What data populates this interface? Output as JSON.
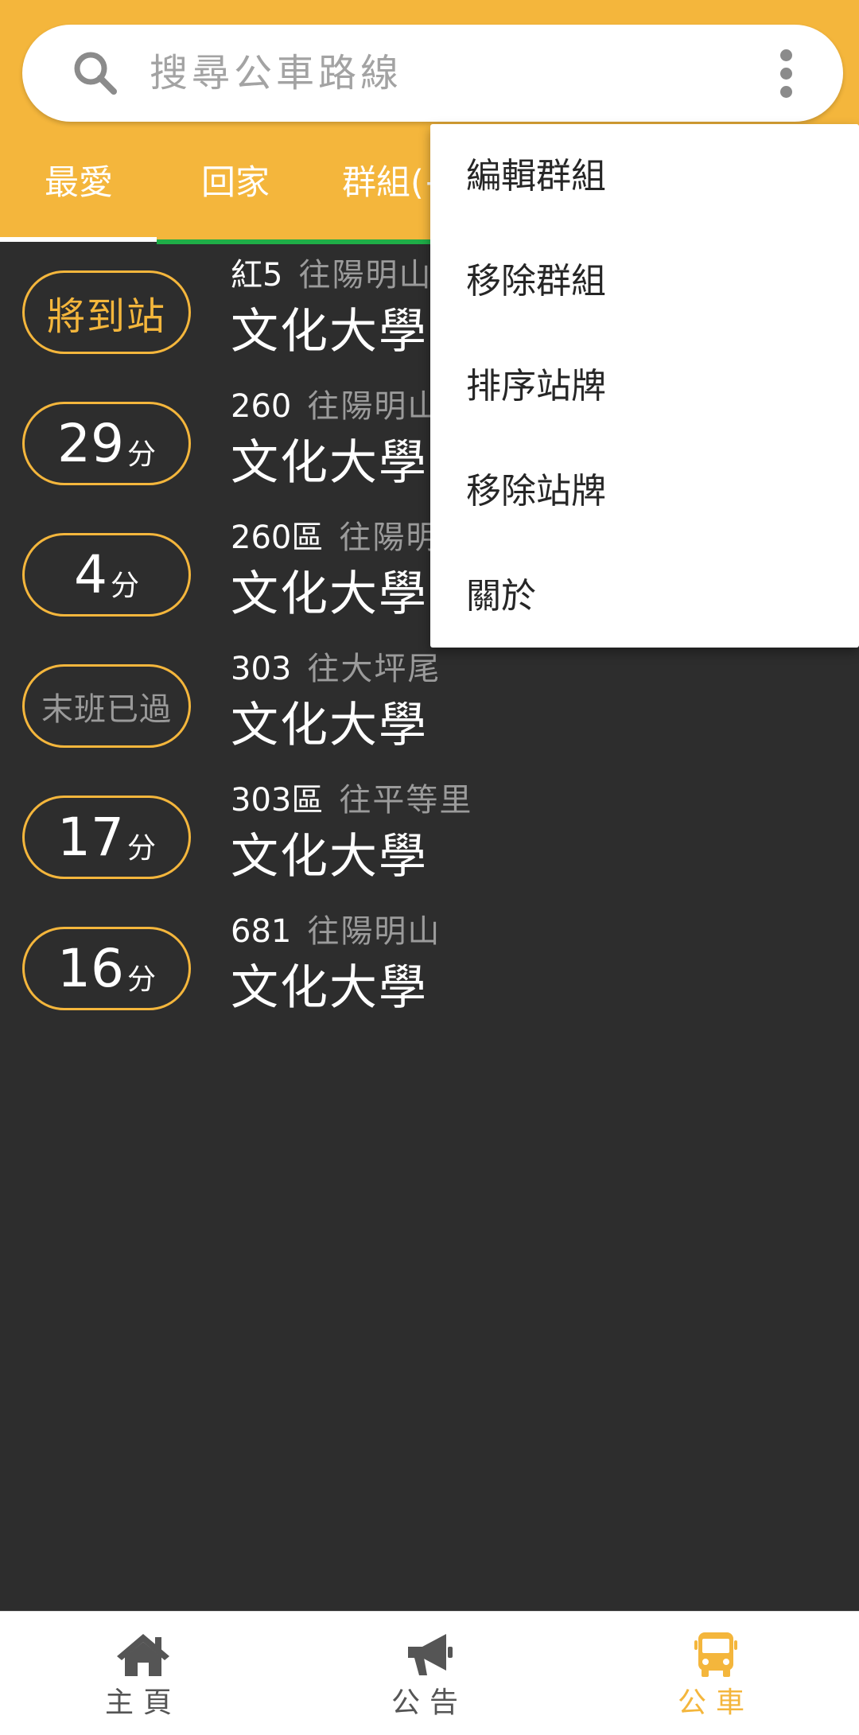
{
  "search": {
    "placeholder": "搜尋公車路線"
  },
  "tabs": [
    "最愛",
    "回家",
    "群組(+"
  ],
  "favorites": [
    {
      "status": "將到站",
      "status_type": "arriving",
      "route": "紅5",
      "direction": "往陽明山",
      "stop": "文化大學"
    },
    {
      "minutes": "29",
      "unit": "分",
      "status_type": "minutes",
      "route": "260",
      "direction": "往陽明山",
      "stop": "文化大學"
    },
    {
      "minutes": "4",
      "unit": "分",
      "status_type": "minutes",
      "route": "260區",
      "direction": "往陽明",
      "stop": "文化大學"
    },
    {
      "status": "末班已過",
      "status_type": "ended",
      "route": "303",
      "direction": "往大坪尾",
      "stop": "文化大學"
    },
    {
      "minutes": "17",
      "unit": "分",
      "status_type": "minutes",
      "route": "303區",
      "direction": "往平等里",
      "stop": "文化大學"
    },
    {
      "minutes": "16",
      "unit": "分",
      "status_type": "minutes",
      "route": "681",
      "direction": "往陽明山",
      "stop": "文化大學"
    }
  ],
  "menu": [
    "編輯群組",
    "移除群組",
    "排序站牌",
    "移除站牌",
    "關於"
  ],
  "bottom_nav": [
    {
      "label": "主頁",
      "icon": "home-icon"
    },
    {
      "label": "公告",
      "icon": "megaphone-icon"
    },
    {
      "label": "公車",
      "icon": "bus-icon",
      "active": true
    }
  ],
  "colors": {
    "accent": "#f4b63c",
    "tab_divider": "#1fad47",
    "background": "#2d2d2d"
  }
}
